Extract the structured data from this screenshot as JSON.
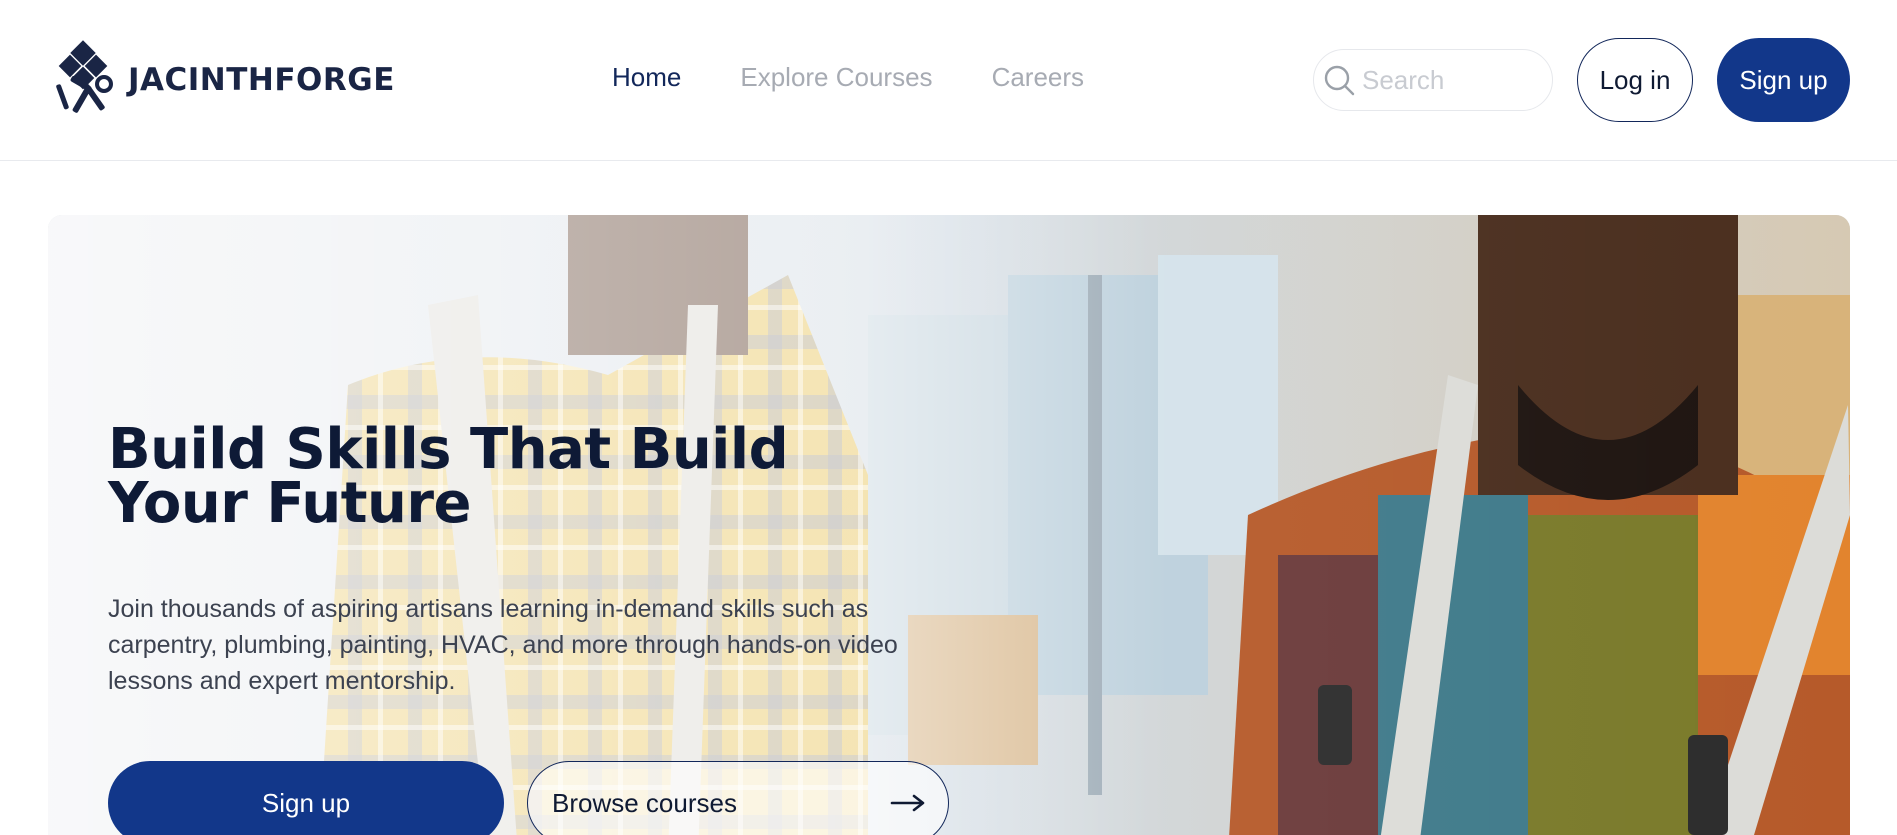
{
  "brand": {
    "name": "JACINTHFORGE",
    "colors": {
      "primary": "#12378a",
      "dark": "#0e1a36",
      "muted_nav": "#a7abb3"
    }
  },
  "nav": {
    "items": [
      {
        "label": "Home",
        "active": true
      },
      {
        "label": "Explore Courses",
        "active": false
      },
      {
        "label": "Careers",
        "active": false
      }
    ]
  },
  "search": {
    "placeholder": "Search",
    "icon": "search-icon"
  },
  "auth": {
    "login_label": "Log in",
    "signup_label": "Sign up"
  },
  "hero": {
    "title": "Build Skills That Build Your Future",
    "subtitle": "Join thousands of aspiring artisans learning in-demand skills such as carpentry, plumbing, painting, HVAC, and more through hands-on video lessons and expert mentorship.",
    "primary_cta": "Sign up",
    "secondary_cta": "Browse courses",
    "secondary_icon": "arrow-right-icon"
  }
}
